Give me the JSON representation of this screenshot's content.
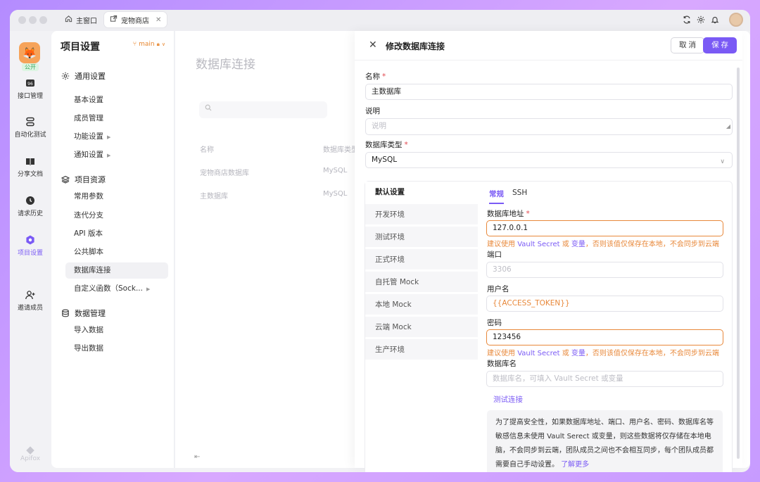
{
  "titlebar": {
    "tabs": [
      {
        "label": "主窗口",
        "icon": "home-icon"
      },
      {
        "label": "宠物商店",
        "icon": "external-link-icon"
      }
    ],
    "icons": [
      "refresh-icon",
      "gear-icon",
      "bell-icon",
      "avatar"
    ]
  },
  "rail": {
    "badge": "公开",
    "items": [
      {
        "label": "接口管理",
        "icon": "api-icon"
      },
      {
        "label": "自动化测试",
        "icon": "automation-icon"
      },
      {
        "label": "分享文档",
        "icon": "book-icon"
      },
      {
        "label": "请求历史",
        "icon": "clock-icon"
      },
      {
        "label": "项目设置",
        "icon": "settings-icon"
      },
      {
        "label": "邀请成员",
        "icon": "add-user-icon"
      }
    ],
    "footer": "Apifox"
  },
  "sidebar": {
    "title": "项目设置",
    "branch": "main",
    "groups": [
      {
        "label": "通用设置",
        "items": [
          "基本设置",
          "成员管理",
          "功能设置",
          "通知设置"
        ]
      },
      {
        "label": "项目资源",
        "items": [
          "常用参数",
          "迭代分支",
          "API 版本",
          "公共脚本",
          "数据库连接",
          "自定义函数（Sock..."
        ]
      },
      {
        "label": "数据管理",
        "items": [
          "导入数据",
          "导出数据"
        ]
      }
    ]
  },
  "main": {
    "title": "数据库连接",
    "columns": [
      "名称",
      "数据库类型"
    ],
    "rows": [
      [
        "宠物商店数据库",
        "MySQL"
      ],
      [
        "主数据库",
        "MySQL"
      ]
    ]
  },
  "drawer": {
    "title": "修改数据库连接",
    "cancel": "取 消",
    "save": "保 存",
    "name_label": "名称",
    "name_value": "主数据库",
    "desc_label": "说明",
    "desc_placeholder": "说明",
    "type_label": "数据库类型",
    "type_value": "MySQL",
    "envs": [
      "默认设置",
      "开发环境",
      "测试环境",
      "正式环境",
      "自托管 Mock",
      "本地 Mock",
      "云端 Mock",
      "生产环境"
    ],
    "subtabs": [
      "常规",
      "SSH"
    ],
    "host_label": "数据库地址",
    "host_value": "127.0.0.1",
    "hint_a": "建议使用 ",
    "hint_vault": "Vault Secret",
    "hint_or": " 或 ",
    "hint_var": "变量",
    "hint_b": "，否则该值仅保存在本地，不会同步到云端",
    "port_label": "端口",
    "port_placeholder": "3306",
    "user_label": "用户名",
    "user_value": "{{ACCESS_TOKEN}}",
    "pwd_label": "密码",
    "pwd_value": "123456",
    "dbname_label": "数据库名",
    "dbname_placeholder": "数据库名，可填入 Vault Secret 或变量",
    "test_link": "测试连接",
    "note_text": "为了提高安全性，如果数据库地址、端口、用户名、密码、数据库名等敏感信息未使用 Vault Serect 或变量，则这些数据将仅存储在本地电脑，不会同步到云端，团队成员之间也不会相互同步，每个团队成员都需要自己手动设置。",
    "note_link": "了解更多"
  },
  "colors": {
    "accent": "#7a5af5",
    "warning": "#e8883a"
  }
}
